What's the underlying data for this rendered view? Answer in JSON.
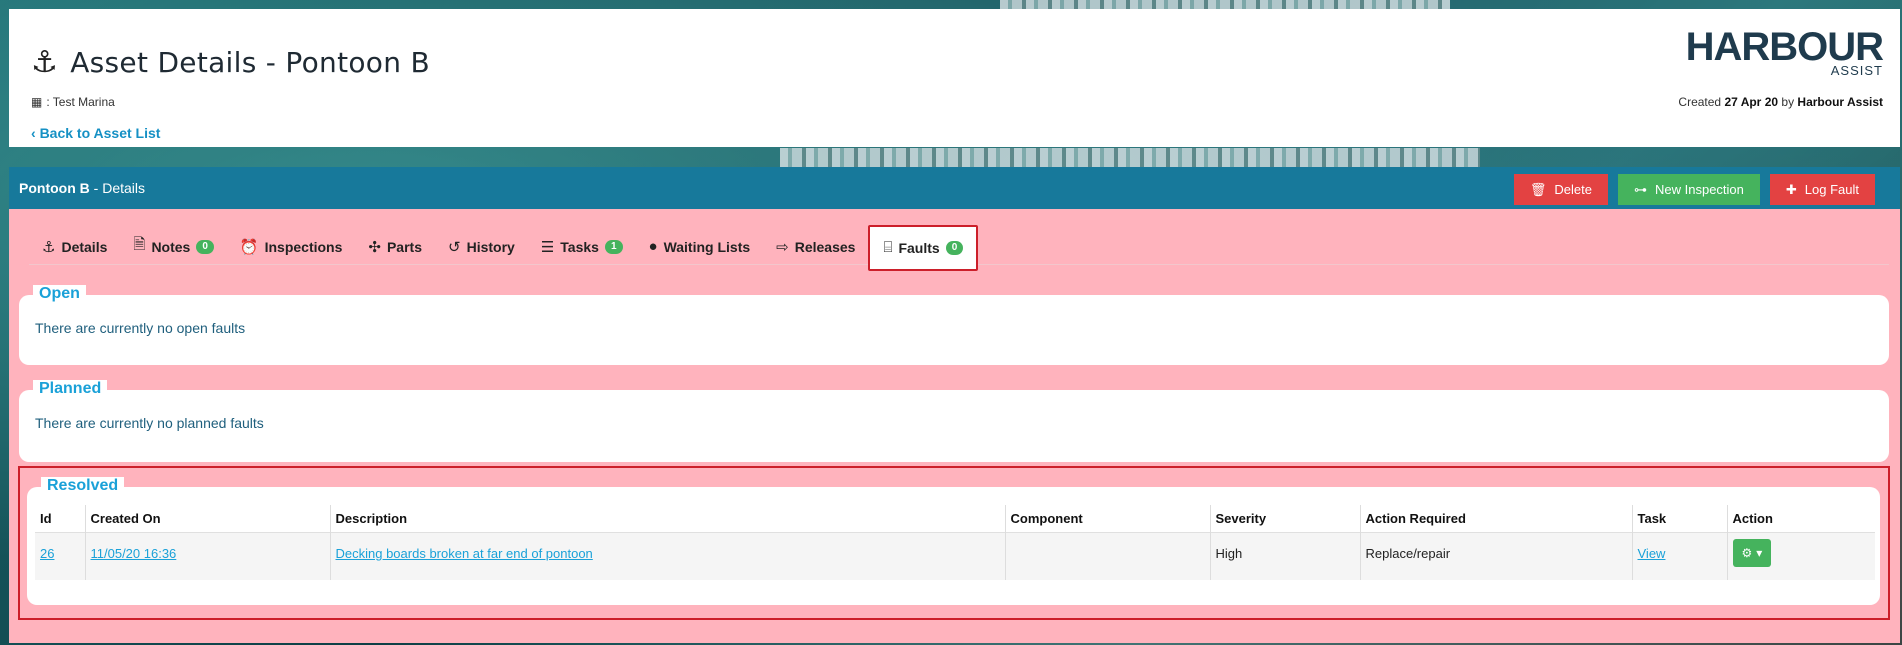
{
  "header": {
    "title": "Asset Details - Pontoon B",
    "marina": ": Test Marina",
    "back_link": "Back to Asset List",
    "logo_brand": "HARBOUR",
    "logo_sub": "ASSIST",
    "created_prefix": "Created",
    "created_date": "27 Apr 20",
    "created_by_prefix": "by",
    "created_by": "Harbour Assist"
  },
  "panel": {
    "title_bold": "Pontoon B",
    "title_suffix": "- Details",
    "buttons": {
      "delete": "Delete",
      "new_inspection": "New Inspection",
      "log_fault": "Log Fault"
    }
  },
  "tabs": [
    {
      "label": "Details",
      "icon": "anchor-icon"
    },
    {
      "label": "Notes",
      "badge": "0",
      "icon": "document-icon"
    },
    {
      "label": "Inspections",
      "icon": "alarm-icon"
    },
    {
      "label": "Parts",
      "icon": "puzzle-icon"
    },
    {
      "label": "History",
      "icon": "history-icon"
    },
    {
      "label": "Tasks",
      "badge": "1",
      "icon": "checklist-icon"
    },
    {
      "label": "Waiting Lists",
      "icon": "clock-icon"
    },
    {
      "label": "Releases",
      "icon": "sign-out-icon"
    },
    {
      "label": "Faults",
      "badge": "0",
      "icon": "toolbox-icon",
      "active": true
    }
  ],
  "sections": {
    "open": {
      "legend": "Open",
      "empty": "There are currently no open faults"
    },
    "planned": {
      "legend": "Planned",
      "empty": "There are currently no planned faults"
    },
    "resolved": {
      "legend": "Resolved",
      "columns": [
        "Id",
        "Created On",
        "Description",
        "Component",
        "Severity",
        "Action Required",
        "Task",
        "Action"
      ],
      "rows": [
        {
          "id": "26",
          "created_on": "11/05/20 16:36",
          "description": "Decking boards broken at far end of pontoon",
          "component": "",
          "severity": "High",
          "action_required": "Replace/repair",
          "task": "View"
        }
      ]
    }
  },
  "colors": {
    "header_bar": "#17799b",
    "panel_bg": "#ffb3bd",
    "accent_link": "#1aa1d8",
    "green": "#45b35d",
    "red": "#e34242",
    "highlight": "#cc1f2a"
  }
}
